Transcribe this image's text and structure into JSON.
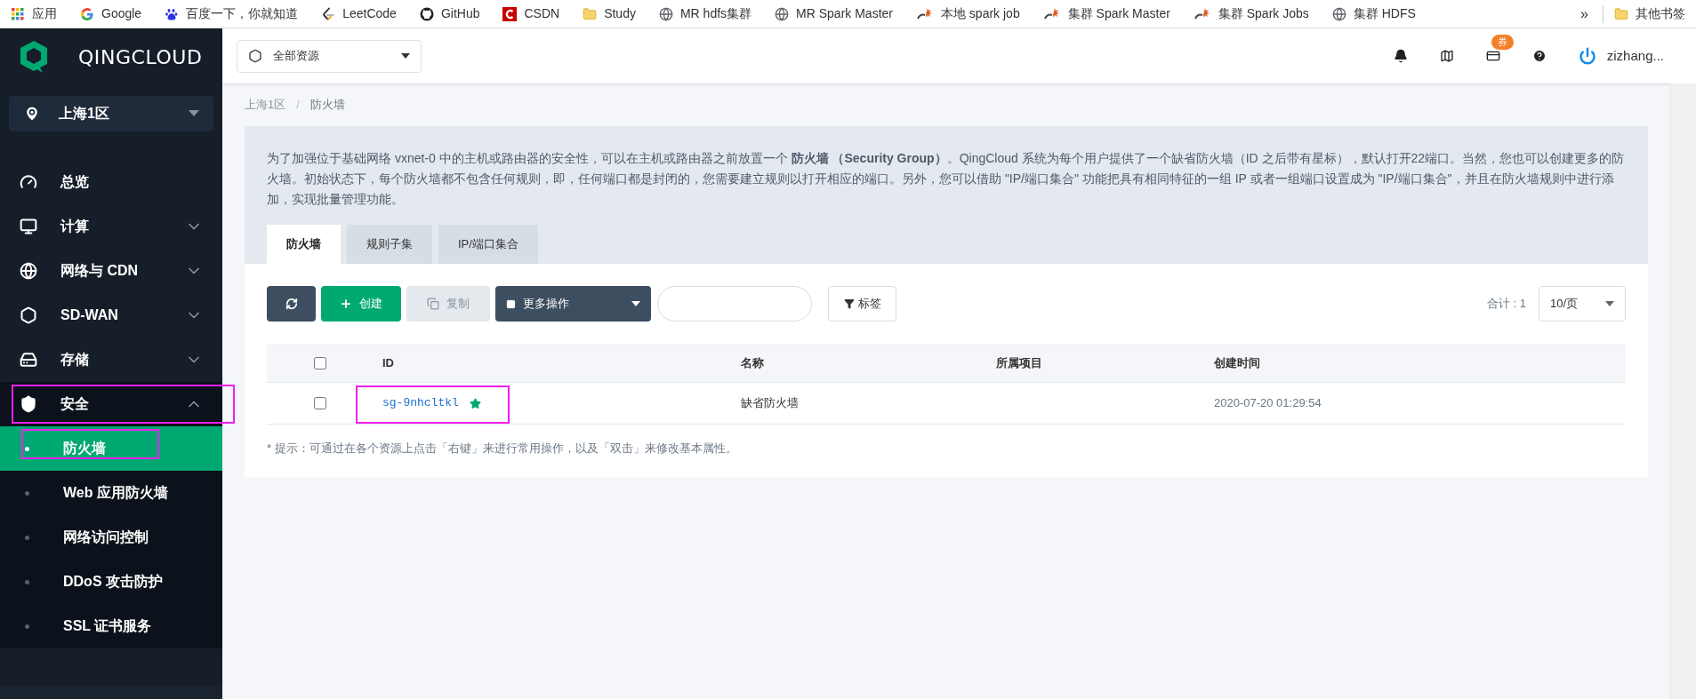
{
  "bookmarks": [
    {
      "label": "应用",
      "kind": "apps"
    },
    {
      "label": "Google",
      "kind": "google"
    },
    {
      "label": "百度一下，你就知道",
      "kind": "baidu"
    },
    {
      "label": "LeetCode",
      "kind": "leetcode"
    },
    {
      "label": "GitHub",
      "kind": "github"
    },
    {
      "label": "CSDN",
      "kind": "csdn"
    },
    {
      "label": "Study",
      "kind": "folder"
    },
    {
      "label": "MR hdfs集群",
      "kind": "globe"
    },
    {
      "label": "MR Spark Master",
      "kind": "globe"
    },
    {
      "label": "本地 spark job",
      "kind": "spark"
    },
    {
      "label": "集群 Spark Master",
      "kind": "spark"
    },
    {
      "label": "集群 Spark Jobs",
      "kind": "spark"
    },
    {
      "label": "集群 HDFS",
      "kind": "globe"
    }
  ],
  "bookmarks_more": "»",
  "other_bookmarks": "其他书签",
  "sidebar": {
    "logo": "QINGCLOUD",
    "region": "上海1区",
    "items": [
      {
        "label": "总览",
        "kind": "gauge"
      },
      {
        "label": "计算",
        "kind": "monitor",
        "expanded": false
      },
      {
        "label": "网络与 CDN",
        "kind": "globe",
        "expanded": false
      },
      {
        "label": "SD-WAN",
        "kind": "hexagon",
        "expanded": false
      },
      {
        "label": "存储",
        "kind": "disk",
        "expanded": false
      },
      {
        "label": "安全",
        "kind": "shield",
        "expanded": true,
        "annotated": true,
        "children": [
          {
            "label": "防火墙",
            "selected": true,
            "annotated": true
          },
          {
            "label": "Web 应用防火墙",
            "selected": false,
            "annotated": false
          },
          {
            "label": "网络访问控制",
            "selected": false,
            "annotated": false
          },
          {
            "label": "DDoS 攻击防护",
            "selected": false,
            "annotated": false
          },
          {
            "label": "SSL 证书服务",
            "selected": false,
            "annotated": false
          }
        ]
      }
    ]
  },
  "header": {
    "resource_selector": "全部资源",
    "coupon_badge": "券",
    "user": "zizhang..."
  },
  "breadcrumb": [
    "上海1区",
    "防火墙"
  ],
  "breadcrumb_separator": "/",
  "description": "为了加强位于基础网络 vxnet-0 中的主机或路由器的安全性，可以在主机或路由器之前放置一个 **防火墙 （Security Group）**。QingCloud 系统为每个用户提供了一个缺省防火墙（ID 之后带有星标），默认打开22端口。当然，您也可以创建更多的防火墙。初始状态下，每个防火墙都不包含任何规则，即，任何端口都是封闭的，您需要建立规则以打开相应的端口。另外，您可以借助 \"IP/端口集合\" 功能把具有相同特征的一组 IP 或者一组端口设置成为 \"IP/端口集合\"，并且在防火墙规则中进行添加，实现批量管理功能。",
  "tabs": [
    {
      "label": "防火墙",
      "selected": true
    },
    {
      "label": "规则子集",
      "selected": false
    },
    {
      "label": "IP/端口集合",
      "selected": false
    }
  ],
  "toolbar": {
    "create": "创建",
    "copy": {
      "label": "复制",
      "disabled": true
    },
    "more": "更多操作",
    "tag": "标签",
    "total": "合计 : 1",
    "page_size": "10/页"
  },
  "table": {
    "header_checked": false,
    "columns": [
      "ID",
      "名称",
      "所属项目",
      "创建时间"
    ],
    "rows": [
      {
        "id": "sg-9nhcltkl",
        "starred": true,
        "annotated": true,
        "checked": false,
        "name": "缺省防火墙",
        "created": "2020-07-20 01:29:54"
      }
    ]
  },
  "hint": "* 提示：可通过在各个资源上点击「右键」来进行常用操作，以及「双击」来修改基本属性。"
}
